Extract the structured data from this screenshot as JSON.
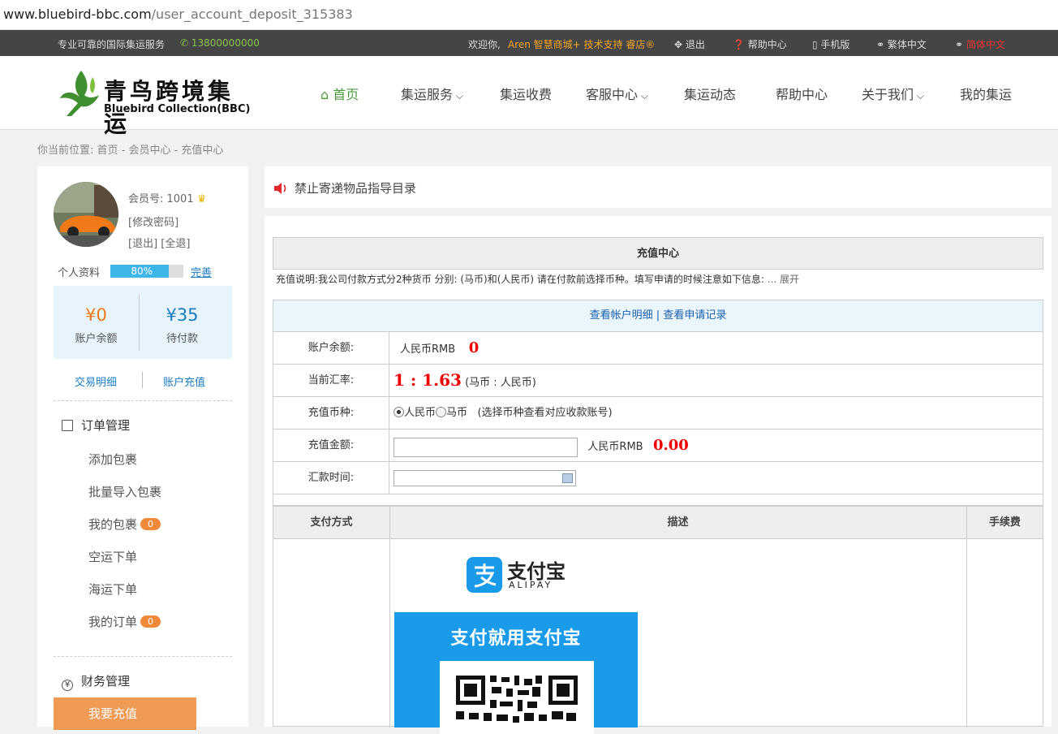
{
  "browser": {
    "url_host": "www.bluebird-bbc.com",
    "url_path": "/user_account_deposit_315383"
  },
  "topbar": {
    "slogan": "专业可靠的国际集运服务",
    "phone": "13800000000",
    "welcome": "欢迎你,",
    "user_orange": "Aren 智慧商城+ 技术支持 睿店®",
    "logout": "退出",
    "help": "帮助中心",
    "mobile": "手机版",
    "traditional": "繁体中文",
    "simplified": "简体中文"
  },
  "logo": {
    "cn": "青鸟跨境集运",
    "en": "Bluebird Collection(BBC)"
  },
  "nav": [
    {
      "label": "首页"
    },
    {
      "label": "集运服务"
    },
    {
      "label": "集运收费"
    },
    {
      "label": "客服中心"
    },
    {
      "label": "集运动态"
    },
    {
      "label": "帮助中心"
    },
    {
      "label": "关于我们"
    },
    {
      "label": "我的集运"
    }
  ],
  "breadcrumb": "你当前位置: 首页 - 会员中心 - 充值中心",
  "member": {
    "id_label": "会员号: 1001",
    "change_password": "[修改密码]",
    "logout_links": "[退出] [全退]",
    "profile_label": "个人资料",
    "profile_percent": "80%",
    "profile_progress": 0.8,
    "complete_link": "完善",
    "balance_value": "¥0",
    "balance_label": "账户余额",
    "pending_value": "¥35",
    "pending_label": "待付款",
    "transactions_link": "交易明细",
    "recharge_link": "账户充值"
  },
  "menu": {
    "orders_title": "订单管理",
    "items": [
      {
        "label": "添加包裹"
      },
      {
        "label": "批量导入包裹"
      },
      {
        "label": "我的包裹",
        "badge": "0"
      },
      {
        "label": "空运下单"
      },
      {
        "label": "海运下单"
      },
      {
        "label": "我的订单",
        "badge": "0"
      }
    ],
    "finance_title": "财务管理",
    "finance_active": "我要充值"
  },
  "notice": "禁止寄递物品指导目录",
  "deposit": {
    "title": "充值中心",
    "desc": "充值说明:我公司付款方式分2种货币 分别: (马币)和(人民币) 请在付款前选择币种。填写申请的时候注意如下信息:",
    "desc_more": "... 展开",
    "records_link1": "查看帐户明细",
    "records_sep": "|",
    "records_link2": "查看申请记录",
    "balance_label": "账户余额:",
    "balance_currency": "人民币RMB",
    "balance_amount": "0",
    "rate_label": "当前汇率:",
    "rate_value": "1 : 1.63",
    "rate_note": "(马币 : 人民币)",
    "currency_label": "充值币种:",
    "currency_rmb": "人民币",
    "currency_myr": "马币",
    "currency_note": "(选择币种查看对应收款账号)",
    "amount_label": "充值金额:",
    "amount_currency": "人民币RMB",
    "amount_value": "0.00",
    "time_label": "汇款时间:",
    "pay_headers": [
      "支付方式",
      "描述",
      "手续费"
    ],
    "alipay_cn": "支付宝",
    "alipay_en": "ALIPAY",
    "alipay_slogan": "支付就用支付宝"
  }
}
